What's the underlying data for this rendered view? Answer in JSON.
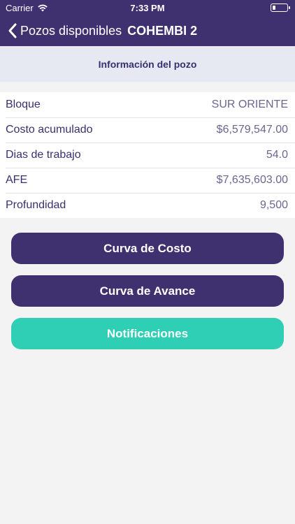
{
  "status_bar": {
    "carrier": "Carrier",
    "time": "7:33 PM",
    "battery_level": 0.25
  },
  "nav": {
    "back_label": "Pozos disponibles",
    "title": "COHEMBI 2"
  },
  "section": {
    "title": "Información del pozo"
  },
  "info": [
    {
      "label": "Bloque",
      "value": "SUR ORIENTE"
    },
    {
      "label": "Costo acumulado",
      "value": "$6,579,547.00"
    },
    {
      "label": "Dias de trabajo",
      "value": "54.0"
    },
    {
      "label": "AFE",
      "value": "$7,635,603.00"
    },
    {
      "label": "Profundidad",
      "value": "9,500"
    }
  ],
  "buttons": {
    "curva_costo": "Curva de Costo",
    "curva_avance": "Curva de Avance",
    "notificaciones": "Notificaciones"
  },
  "colors": {
    "primary": "#3f3170",
    "accent": "#2ecfb4",
    "section_bg": "#e6e9f1",
    "page_bg": "#f3f3f3"
  }
}
